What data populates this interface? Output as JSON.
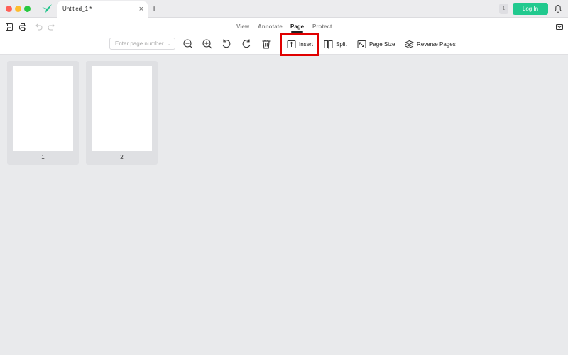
{
  "titlebar": {
    "tab_title": "Untitled_1 *",
    "tab_close": "×",
    "tab_add": "+",
    "notification_count": "1",
    "login_label": "Log In"
  },
  "menu": {
    "tabs": [
      {
        "label": "View",
        "active": false
      },
      {
        "label": "Annotate",
        "active": false
      },
      {
        "label": "Page",
        "active": true
      },
      {
        "label": "Protect",
        "active": false
      }
    ]
  },
  "toolbar": {
    "page_input_placeholder": "Enter page number",
    "actions": {
      "insert": "Insert",
      "split": "Split",
      "page_size": "Page Size",
      "reverse_pages": "Reverse Pages"
    }
  },
  "pages": [
    {
      "number": "1"
    },
    {
      "number": "2"
    }
  ],
  "colors": {
    "accent": "#21c98e",
    "highlight": "#e00000"
  }
}
